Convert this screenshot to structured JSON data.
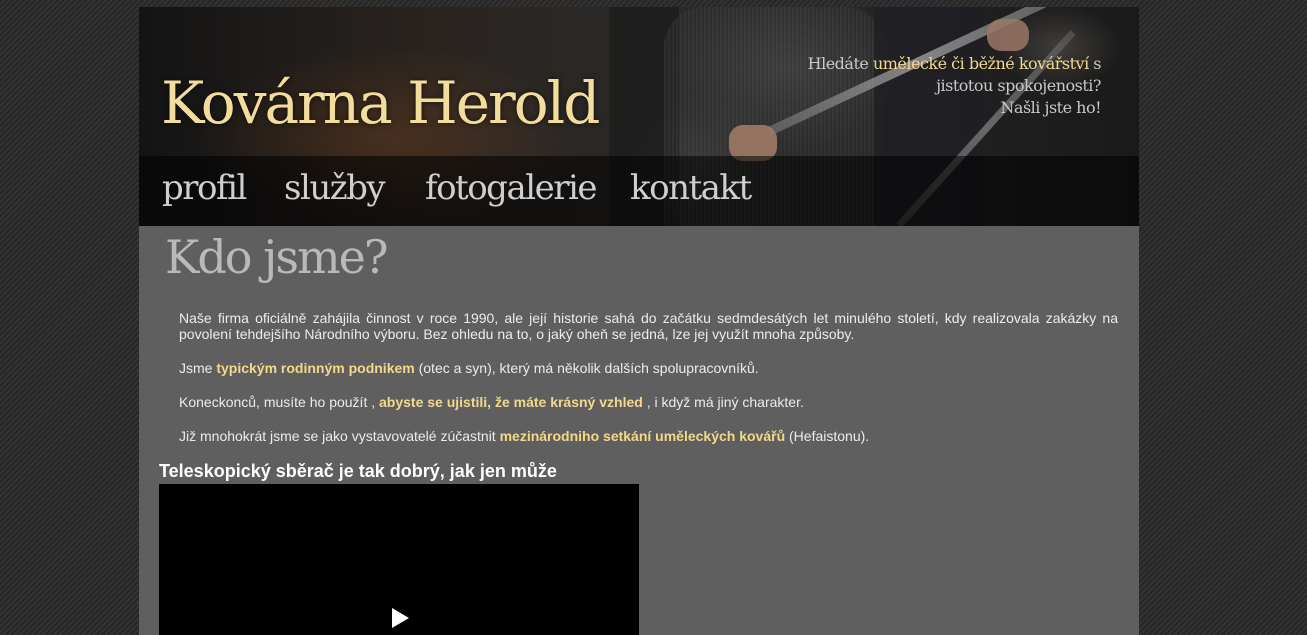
{
  "header": {
    "site_title": "Kovárna Herold",
    "tagline": {
      "part1": "Hledáte ",
      "highlight1": "umělecké či běžné kovářství",
      "part2": " s jistotou spokojenosti?",
      "line3": "Našli jste ho!"
    }
  },
  "nav": {
    "items": [
      {
        "label": "profil"
      },
      {
        "label": "služby"
      },
      {
        "label": "fotogalerie"
      },
      {
        "label": "kontakt"
      }
    ]
  },
  "main": {
    "heading": "Kdo jsme?",
    "paragraphs": [
      {
        "text": "Naše firma oficiálně zahájila činnost v roce 1990, ale její historie sahá do začátku sedmdesátých let minulého století, kdy realizovala zakázky na povolení tehdejšího Národního výboru. Bez ohledu na to, o jaký oheň se jedná, lze jej využít mnoha způsoby."
      },
      {
        "before": "Jsme ",
        "highlight": "typickým rodinným podnikem",
        "after": " (otec a syn), který má několik dalších spolupracovníků."
      },
      {
        "before": "Koneckonců, musíte ho použít , ",
        "highlight": "abyste se ujistili, že máte krásný vzhled",
        "after": " , i když má jiný charakter."
      },
      {
        "before": "Již mnohokrát jsme se jako vystavovatelé zúčastnit ",
        "highlight": "mezinárodniho setkání uměleckých kovářů",
        "after": " (Hefaistonu)."
      }
    ],
    "video_title": "Teleskopický sběrač je tak dobrý, jak jen může"
  },
  "colors": {
    "accent": "#f3d98c",
    "page_bg": "#5f5f5f",
    "nav_text": "#cfcfcf"
  },
  "icons": {
    "play": "play-icon"
  }
}
